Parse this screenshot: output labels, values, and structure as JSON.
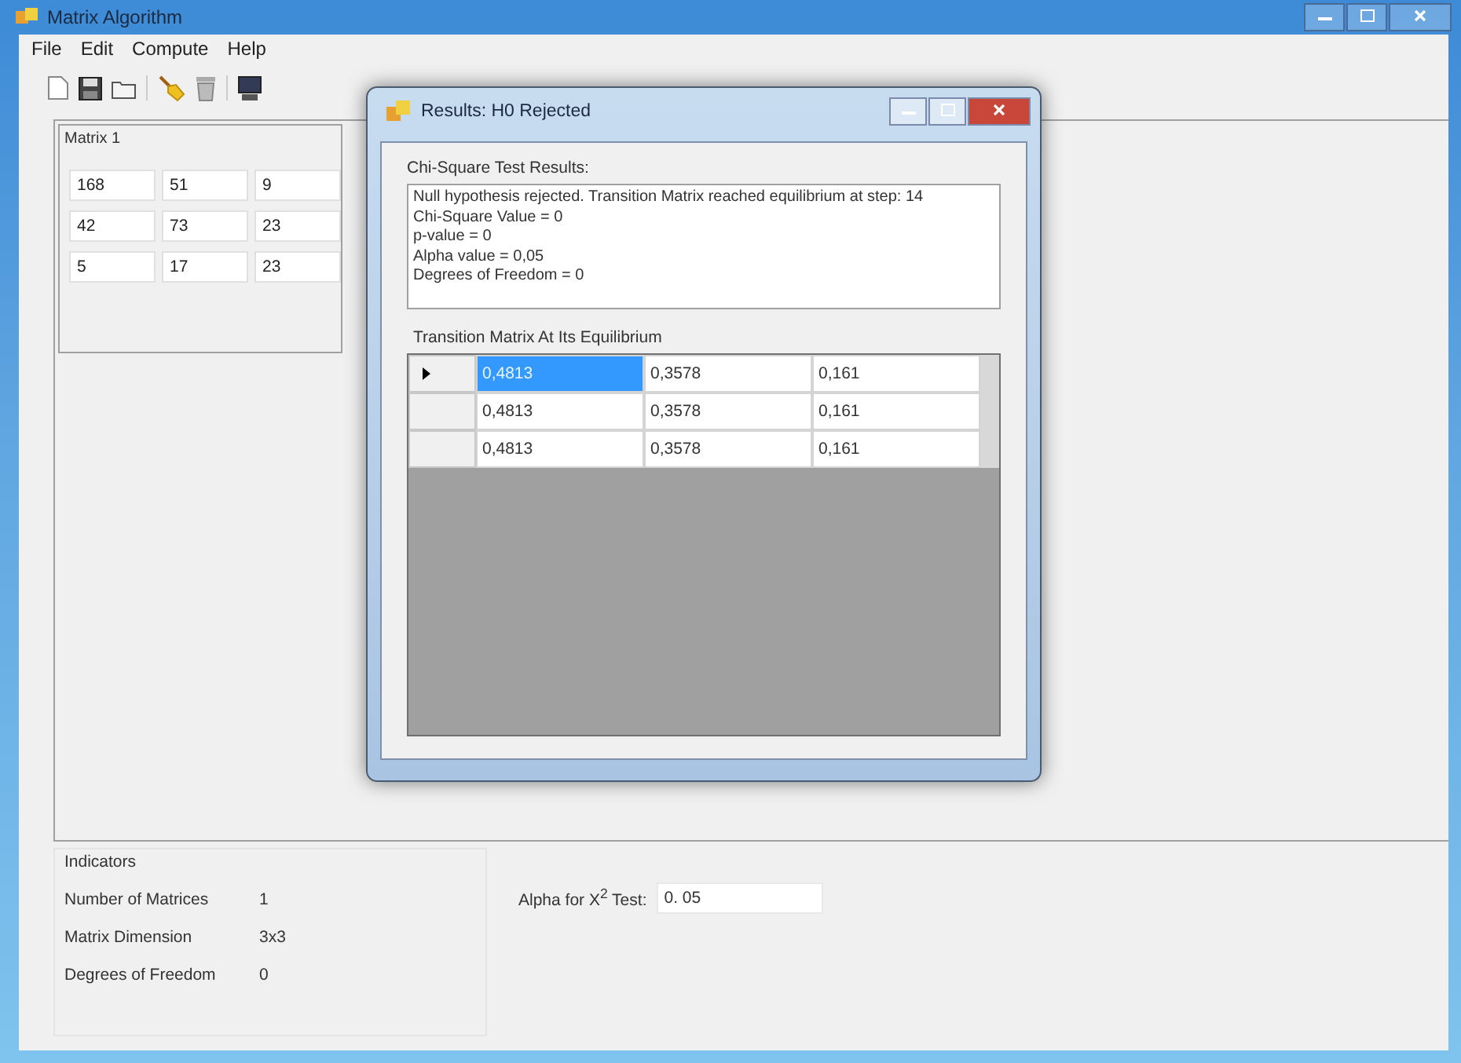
{
  "window": {
    "title": "Matrix Algorithm"
  },
  "menu": [
    "File",
    "Edit",
    "Compute",
    "Help"
  ],
  "matrix_group": {
    "title": "Matrix 1",
    "rows": [
      [
        "168",
        "51",
        "9"
      ],
      [
        "42",
        "73",
        "23"
      ],
      [
        "5",
        "17",
        "23"
      ]
    ]
  },
  "indicators": {
    "title": "Indicators",
    "items": [
      {
        "label": "Number of Matrices",
        "value": "1"
      },
      {
        "label": "Matrix Dimension",
        "value": "3x3"
      },
      {
        "label": "Degrees of Freedom",
        "value": "0"
      }
    ]
  },
  "alpha": {
    "label": "Alpha for X$^{2}$ Test:",
    "value": "0. 05"
  },
  "dialog": {
    "title": "Results: H0 Rejected",
    "results_label": "Chi-Square Test Results:",
    "results_lines": [
      "Null hypothesis rejected. Transition Matrix reached equilibrium at step: 14",
      "Chi-Square Value = 0",
      "p-value = 0",
      "Alpha value = 0,05",
      "Degrees of Freedom = 0"
    ],
    "grid_label": "Transition Matrix At Its Equilibrium",
    "grid_rows": [
      {
        "current": true,
        "cells": [
          {
            "text": "0,4813",
            "selected": true
          },
          {
            "text": "0,3578",
            "selected": false
          },
          {
            "text": "0,161",
            "selected": false
          }
        ]
      },
      {
        "current": false,
        "cells": [
          {
            "text": "0,4813",
            "selected": false
          },
          {
            "text": "0,3578",
            "selected": false
          },
          {
            "text": "0,161",
            "selected": false
          }
        ]
      },
      {
        "current": false,
        "cells": [
          {
            "text": "0,4813",
            "selected": false
          },
          {
            "text": "0,3578",
            "selected": false
          },
          {
            "text": "0,161",
            "selected": false
          }
        ]
      }
    ]
  }
}
